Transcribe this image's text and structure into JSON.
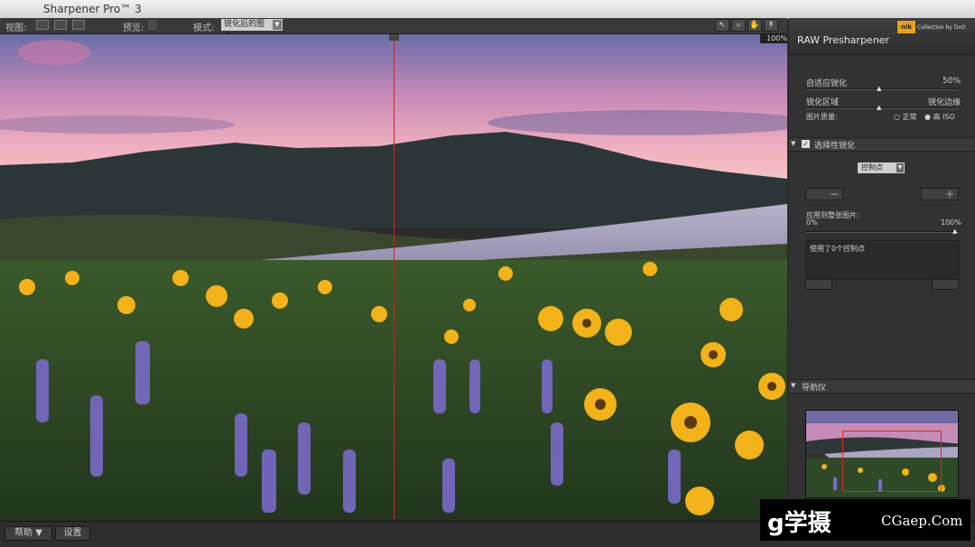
{
  "app": {
    "title": "Sharpener Pro™ 3"
  },
  "toolbar": {
    "view_label": "视图:",
    "preview_label": "预览:",
    "mode_label": "模式:",
    "mode_value": "锐化后的图片",
    "zoom": "100%"
  },
  "panel": {
    "title": "RAW Presharpener",
    "brand_logo": "nik",
    "brand_sub": "Collection by DxO",
    "adaptive_label": "自适应锐化",
    "adaptive_value": "50%",
    "sharpen_areas_label": "锐化区域",
    "sharpen_edges_label": "锐化边缘",
    "image_quality_label": "图片质量:",
    "quality_normal": "正常",
    "quality_high": "高 ISO",
    "selective_section": "选择性锐化",
    "control_point_dd": "控制点",
    "apply_label": "应用到整张图片:",
    "apply_min": "0%",
    "apply_max": "100%",
    "info_text": "使用了0个控制点",
    "navigator_section": "导航仪"
  },
  "bottom": {
    "help_label": "帮助 ▼",
    "settings_label": "设置"
  },
  "watermark": {
    "logo": "g学摄",
    "site": "CGaep.Com"
  },
  "colors": {
    "split_line": "#d42020",
    "nik_accent": "#e8a21a"
  }
}
